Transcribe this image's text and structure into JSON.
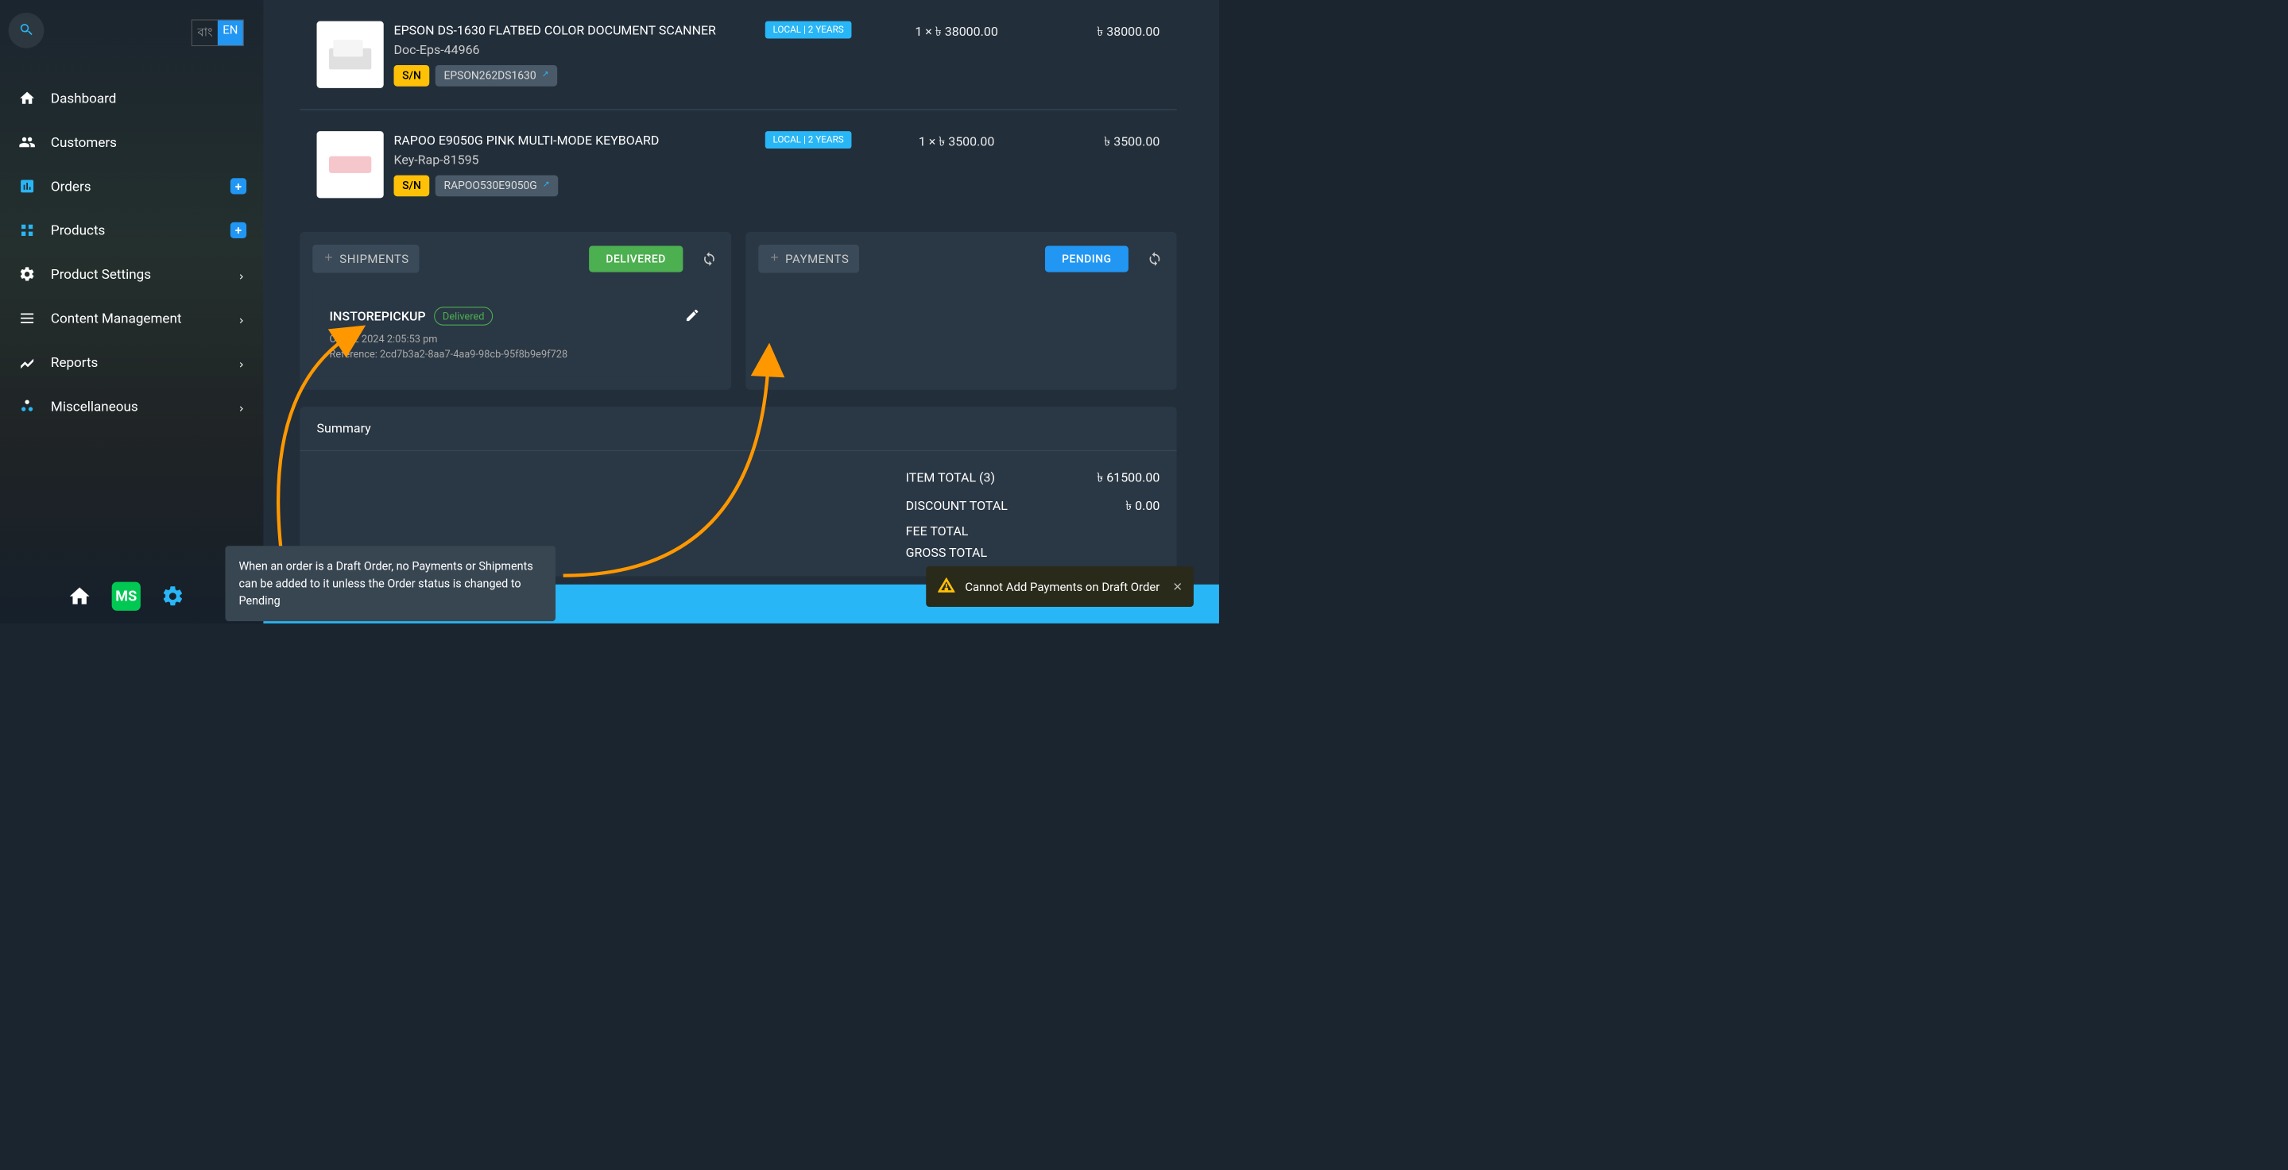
{
  "lang": {
    "bn": "বাং",
    "en": "EN"
  },
  "sidebar": {
    "items": [
      {
        "label": "Dashboard"
      },
      {
        "label": "Customers"
      },
      {
        "label": "Orders"
      },
      {
        "label": "Products"
      },
      {
        "label": "Product Settings"
      },
      {
        "label": "Content Management"
      },
      {
        "label": "Reports"
      },
      {
        "label": "Miscellaneous"
      }
    ],
    "ms_badge": "MS"
  },
  "line_items": [
    {
      "title": "EPSON DS-1630 FLATBED COLOR DOCUMENT SCANNER",
      "sku": "Doc-Eps-44966",
      "sn_label": "S/N",
      "sn_value": "EPSON262DS1630",
      "warranty": "LOCAL | 2 YEARS",
      "qty_price": "1 × ৳ 38000.00",
      "line_total": "৳ 38000.00"
    },
    {
      "title": "RAPOO E9050G PINK MULTI-MODE KEYBOARD",
      "sku": "Key-Rap-81595",
      "sn_label": "S/N",
      "sn_value": "RAPOO530E9050G",
      "warranty": "LOCAL | 2 YEARS",
      "qty_price": "1 × ৳ 3500.00",
      "line_total": "৳ 3500.00"
    }
  ],
  "shipments": {
    "add_label": "SHIPMENTS",
    "status_btn": "DELIVERED",
    "entry": {
      "type": "INSTOREPICKUP",
      "status_pill": "Delivered",
      "date": "Oct 02 2024 2:05:53 pm",
      "reference_label": "Reference:",
      "reference": "2cd7b3a2-8aa7-4aa9-98cb-95f8b9e9f728"
    }
  },
  "payments": {
    "add_label": "PAYMENTS",
    "status_btn": "PENDING"
  },
  "summary": {
    "title": "Summary",
    "rows": [
      {
        "label": "ITEM TOTAL (3)",
        "value": "৳ 61500.00"
      },
      {
        "label": "DISCOUNT TOTAL",
        "value": "৳ 0.00"
      },
      {
        "label": "FEE TOTAL",
        "value": ""
      },
      {
        "label": "GROSS TOTAL",
        "value": ""
      }
    ]
  },
  "callout": {
    "text": "When an order is a Draft Order, no Payments or Shipments can be added to it unless the Order status is changed to Pending"
  },
  "toast": {
    "message": "Cannot Add Payments on Draft Order"
  }
}
